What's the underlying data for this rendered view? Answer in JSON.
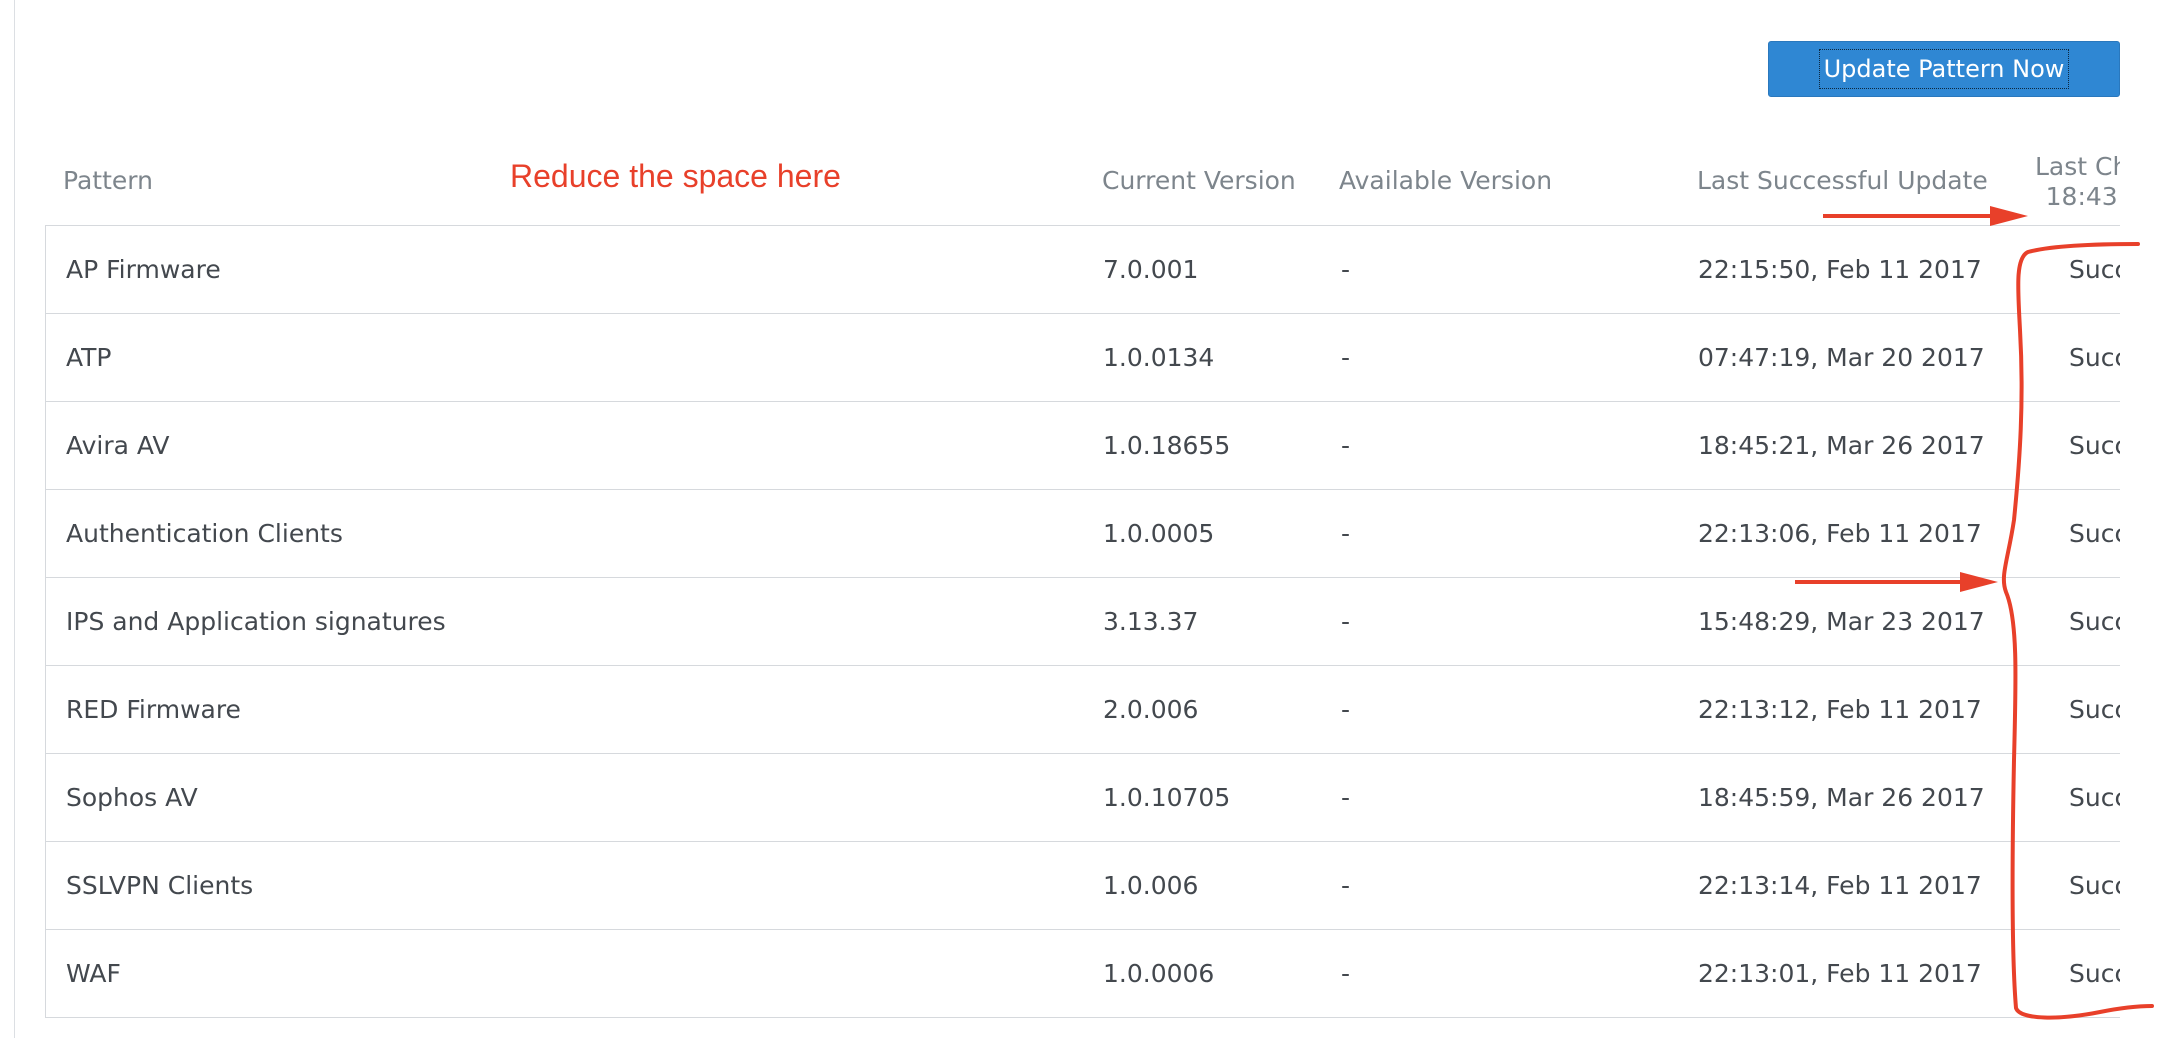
{
  "toolbar": {
    "update_button_label": "Update Pattern Now"
  },
  "annotation": {
    "text": "Reduce the space here",
    "color": "#e8402a"
  },
  "table": {
    "headers": {
      "pattern": "Pattern",
      "current_version": "Current Version",
      "available_version": "Available Version",
      "last_successful_update": "Last Successful Update",
      "last_check_line1": "Last Ch",
      "last_check_line2": "18:43"
    },
    "rows": [
      {
        "pattern": "AP Firmware",
        "current": "7.0.001",
        "available": "-",
        "last_update": "22:15:50, Feb 11 2017",
        "status": "Succes"
      },
      {
        "pattern": "ATP",
        "current": "1.0.0134",
        "available": "-",
        "last_update": "07:47:19, Mar 20 2017",
        "status": "Succes"
      },
      {
        "pattern": "Avira AV",
        "current": "1.0.18655",
        "available": "-",
        "last_update": "18:45:21, Mar 26 2017",
        "status": "Succes"
      },
      {
        "pattern": "Authentication Clients",
        "current": "1.0.0005",
        "available": "-",
        "last_update": "22:13:06, Feb 11 2017",
        "status": "Succes"
      },
      {
        "pattern": "IPS and Application signatures",
        "current": "3.13.37",
        "available": "-",
        "last_update": "15:48:29, Mar 23 2017",
        "status": "Succes"
      },
      {
        "pattern": "RED Firmware",
        "current": "2.0.006",
        "available": "-",
        "last_update": "22:13:12, Feb 11 2017",
        "status": "Succes"
      },
      {
        "pattern": "Sophos AV",
        "current": "1.0.10705",
        "available": "-",
        "last_update": "18:45:59, Mar 26 2017",
        "status": "Succes"
      },
      {
        "pattern": "SSLVPN Clients",
        "current": "1.0.006",
        "available": "-",
        "last_update": "22:13:14, Feb 11 2017",
        "status": "Succes"
      },
      {
        "pattern": "WAF",
        "current": "1.0.0006",
        "available": "-",
        "last_update": "22:13:01, Feb 11 2017",
        "status": "Succes"
      }
    ]
  }
}
